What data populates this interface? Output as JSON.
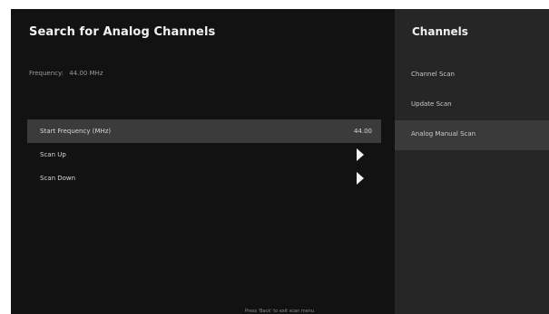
{
  "main": {
    "title": "Search for Analog Channels",
    "frequency": {
      "label": "Frequency",
      "value": "44.00 MHz"
    },
    "rows": [
      {
        "label": "Start Frequency (MHz)",
        "value": "44.00",
        "selected": true
      },
      {
        "label": "Scan Up",
        "icon": "play-icon"
      },
      {
        "label": "Scan Down",
        "icon": "play-icon"
      }
    ],
    "hint": "Press 'Back' to exit scan menu"
  },
  "sidebar": {
    "title": "Channels",
    "items": [
      {
        "label": "Channel Scan"
      },
      {
        "label": "Update Scan"
      },
      {
        "label": "Analog Manual Scan",
        "active": true
      }
    ]
  },
  "colors": {
    "main_background": "#121212",
    "side_background": "#262626",
    "selection": "#3b3b3b"
  }
}
